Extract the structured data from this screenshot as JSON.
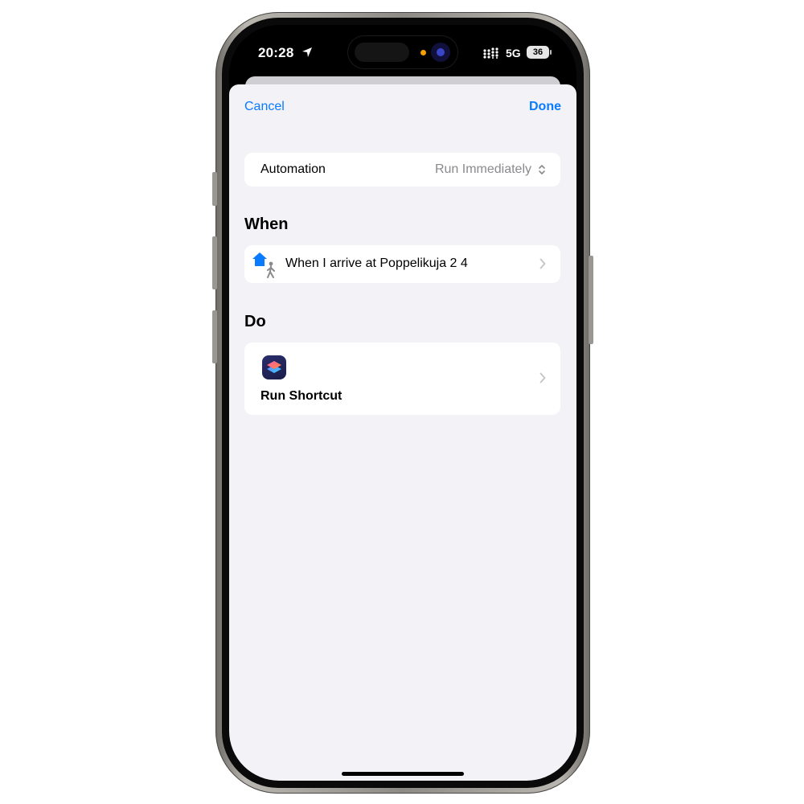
{
  "status_bar": {
    "time": "20:28",
    "network": "5G",
    "battery": "36"
  },
  "nav": {
    "cancel": "Cancel",
    "done": "Done"
  },
  "automation_row": {
    "label": "Automation",
    "value": "Run Immediately"
  },
  "when_section": {
    "title": "When",
    "trigger_text": "When I arrive at Poppelikuja 2 4",
    "icon": "home-arrive-icon"
  },
  "do_section": {
    "title": "Do",
    "action_text": "Run Shortcut",
    "icon": "shortcuts-app-icon"
  },
  "colors": {
    "accent": "#0a7aff",
    "background": "#f2f2f7",
    "card": "#ffffff",
    "secondary_text": "#8a8a8e"
  }
}
